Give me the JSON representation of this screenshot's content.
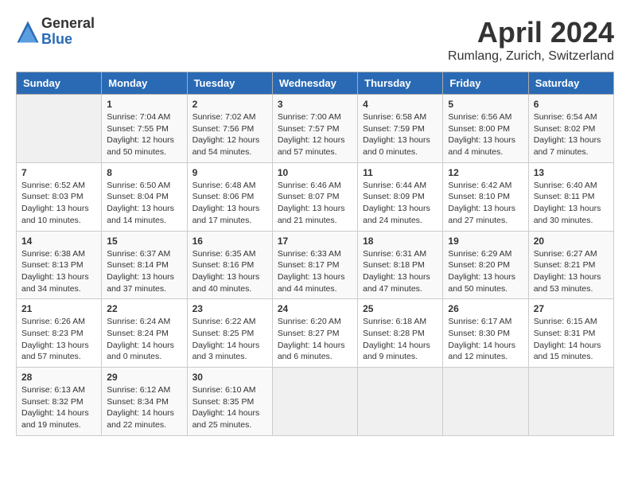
{
  "header": {
    "logo_general": "General",
    "logo_blue": "Blue",
    "month_title": "April 2024",
    "location": "Rumlang, Zurich, Switzerland"
  },
  "days_of_week": [
    "Sunday",
    "Monday",
    "Tuesday",
    "Wednesday",
    "Thursday",
    "Friday",
    "Saturday"
  ],
  "weeks": [
    [
      {
        "day": "",
        "content": ""
      },
      {
        "day": "1",
        "content": "Sunrise: 7:04 AM\nSunset: 7:55 PM\nDaylight: 12 hours\nand 50 minutes."
      },
      {
        "day": "2",
        "content": "Sunrise: 7:02 AM\nSunset: 7:56 PM\nDaylight: 12 hours\nand 54 minutes."
      },
      {
        "day": "3",
        "content": "Sunrise: 7:00 AM\nSunset: 7:57 PM\nDaylight: 12 hours\nand 57 minutes."
      },
      {
        "day": "4",
        "content": "Sunrise: 6:58 AM\nSunset: 7:59 PM\nDaylight: 13 hours\nand 0 minutes."
      },
      {
        "day": "5",
        "content": "Sunrise: 6:56 AM\nSunset: 8:00 PM\nDaylight: 13 hours\nand 4 minutes."
      },
      {
        "day": "6",
        "content": "Sunrise: 6:54 AM\nSunset: 8:02 PM\nDaylight: 13 hours\nand 7 minutes."
      }
    ],
    [
      {
        "day": "7",
        "content": "Sunrise: 6:52 AM\nSunset: 8:03 PM\nDaylight: 13 hours\nand 10 minutes."
      },
      {
        "day": "8",
        "content": "Sunrise: 6:50 AM\nSunset: 8:04 PM\nDaylight: 13 hours\nand 14 minutes."
      },
      {
        "day": "9",
        "content": "Sunrise: 6:48 AM\nSunset: 8:06 PM\nDaylight: 13 hours\nand 17 minutes."
      },
      {
        "day": "10",
        "content": "Sunrise: 6:46 AM\nSunset: 8:07 PM\nDaylight: 13 hours\nand 21 minutes."
      },
      {
        "day": "11",
        "content": "Sunrise: 6:44 AM\nSunset: 8:09 PM\nDaylight: 13 hours\nand 24 minutes."
      },
      {
        "day": "12",
        "content": "Sunrise: 6:42 AM\nSunset: 8:10 PM\nDaylight: 13 hours\nand 27 minutes."
      },
      {
        "day": "13",
        "content": "Sunrise: 6:40 AM\nSunset: 8:11 PM\nDaylight: 13 hours\nand 30 minutes."
      }
    ],
    [
      {
        "day": "14",
        "content": "Sunrise: 6:38 AM\nSunset: 8:13 PM\nDaylight: 13 hours\nand 34 minutes."
      },
      {
        "day": "15",
        "content": "Sunrise: 6:37 AM\nSunset: 8:14 PM\nDaylight: 13 hours\nand 37 minutes."
      },
      {
        "day": "16",
        "content": "Sunrise: 6:35 AM\nSunset: 8:16 PM\nDaylight: 13 hours\nand 40 minutes."
      },
      {
        "day": "17",
        "content": "Sunrise: 6:33 AM\nSunset: 8:17 PM\nDaylight: 13 hours\nand 44 minutes."
      },
      {
        "day": "18",
        "content": "Sunrise: 6:31 AM\nSunset: 8:18 PM\nDaylight: 13 hours\nand 47 minutes."
      },
      {
        "day": "19",
        "content": "Sunrise: 6:29 AM\nSunset: 8:20 PM\nDaylight: 13 hours\nand 50 minutes."
      },
      {
        "day": "20",
        "content": "Sunrise: 6:27 AM\nSunset: 8:21 PM\nDaylight: 13 hours\nand 53 minutes."
      }
    ],
    [
      {
        "day": "21",
        "content": "Sunrise: 6:26 AM\nSunset: 8:23 PM\nDaylight: 13 hours\nand 57 minutes."
      },
      {
        "day": "22",
        "content": "Sunrise: 6:24 AM\nSunset: 8:24 PM\nDaylight: 14 hours\nand 0 minutes."
      },
      {
        "day": "23",
        "content": "Sunrise: 6:22 AM\nSunset: 8:25 PM\nDaylight: 14 hours\nand 3 minutes."
      },
      {
        "day": "24",
        "content": "Sunrise: 6:20 AM\nSunset: 8:27 PM\nDaylight: 14 hours\nand 6 minutes."
      },
      {
        "day": "25",
        "content": "Sunrise: 6:18 AM\nSunset: 8:28 PM\nDaylight: 14 hours\nand 9 minutes."
      },
      {
        "day": "26",
        "content": "Sunrise: 6:17 AM\nSunset: 8:30 PM\nDaylight: 14 hours\nand 12 minutes."
      },
      {
        "day": "27",
        "content": "Sunrise: 6:15 AM\nSunset: 8:31 PM\nDaylight: 14 hours\nand 15 minutes."
      }
    ],
    [
      {
        "day": "28",
        "content": "Sunrise: 6:13 AM\nSunset: 8:32 PM\nDaylight: 14 hours\nand 19 minutes."
      },
      {
        "day": "29",
        "content": "Sunrise: 6:12 AM\nSunset: 8:34 PM\nDaylight: 14 hours\nand 22 minutes."
      },
      {
        "day": "30",
        "content": "Sunrise: 6:10 AM\nSunset: 8:35 PM\nDaylight: 14 hours\nand 25 minutes."
      },
      {
        "day": "",
        "content": ""
      },
      {
        "day": "",
        "content": ""
      },
      {
        "day": "",
        "content": ""
      },
      {
        "day": "",
        "content": ""
      }
    ]
  ]
}
